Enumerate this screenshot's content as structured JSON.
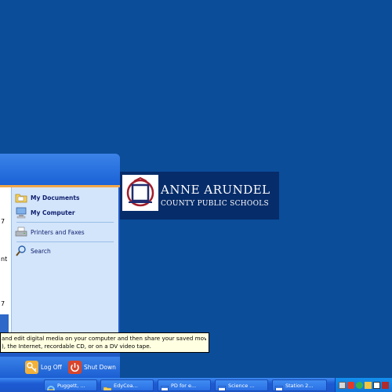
{
  "wallpaper_logo": {
    "line1": "ANNE ARUNDEL",
    "line2": "COUNTY PUBLIC SCHOOLS"
  },
  "start_menu": {
    "left_fragments": [
      "7",
      "nt",
      "7"
    ],
    "right_items": [
      {
        "label": "My Documents",
        "icon": "folder-documents-icon",
        "bold": true
      },
      {
        "label": "My Computer",
        "icon": "computer-icon",
        "bold": true
      },
      {
        "label": "Printers and Faxes",
        "icon": "printer-icon",
        "bold": false
      },
      {
        "label": "Search",
        "icon": "search-icon",
        "bold": false
      }
    ],
    "footer": {
      "log_off": "Log Off",
      "shut_down": "Shut Down"
    }
  },
  "tooltip": {
    "line1": "and edit digital media on your computer and then share your saved movies",
    "line2": "), the Internet, recordable CD, or on a DV video tape."
  },
  "taskbar": {
    "buttons": [
      {
        "label": "Puggett, ...",
        "icon": "ie-icon"
      },
      {
        "label": "EdyCoa...",
        "icon": "folder-icon"
      },
      {
        "label": "PD for e...",
        "icon": "window-icon"
      },
      {
        "label": "Science ...",
        "icon": "window-icon"
      },
      {
        "label": "Station 2...",
        "icon": "window-icon"
      }
    ]
  },
  "colors": {
    "desktop": "#0b4d99",
    "menu_blue": "#1f5ac7",
    "menu_right_pane": "#d3e5fa",
    "tray": "#1390ee",
    "tooltip_bg": "#ffffe1"
  }
}
